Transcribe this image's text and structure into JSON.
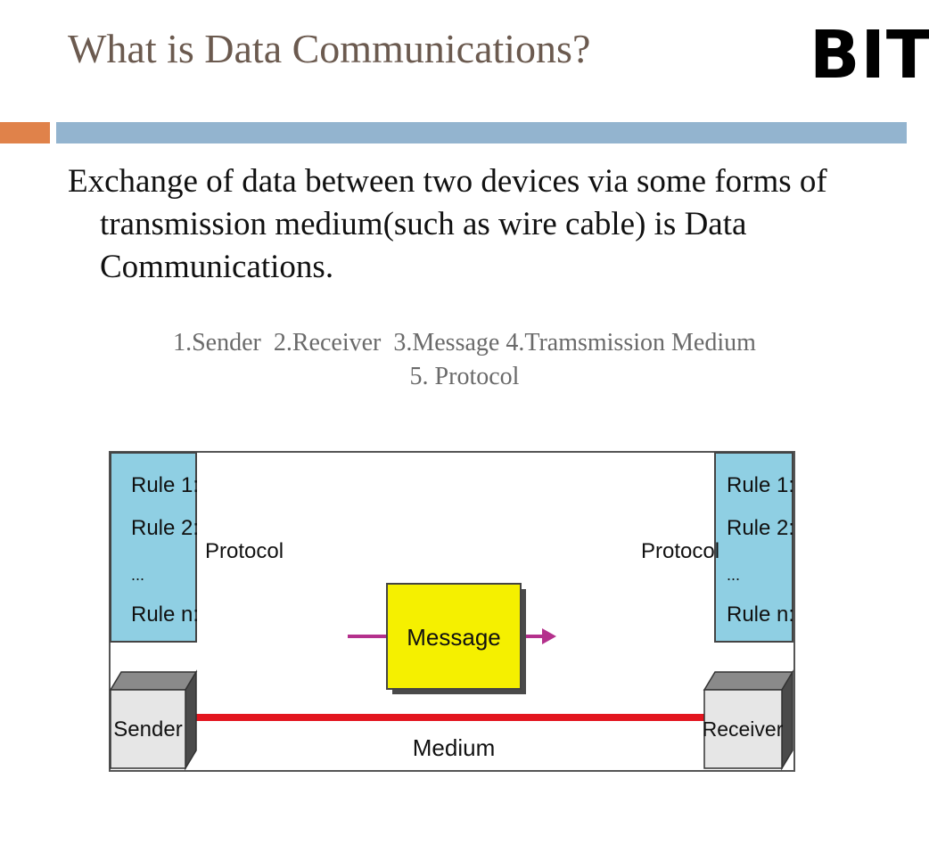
{
  "slide": {
    "title": "What is Data Communications?",
    "logo": "BIT",
    "definition": "Exchange of data between two devices via some forms of transmission medium(such as wire cable) is Data Communications.",
    "components_line1": "1.Sender  2.Receiver  3.Message 4.Tramsmission Medium",
    "components_line2": "5. Protocol",
    "accent_colors": {
      "title": "#6b5a4f",
      "orange_bar": "#e0824a",
      "blue_bar": "#93b4cf"
    }
  },
  "diagram": {
    "left_rules": [
      "Rule 1:",
      "Rule 2:",
      "...",
      "Rule n:"
    ],
    "right_rules": [
      "Rule 1:",
      "Rule 2:",
      "...",
      "Rule n:"
    ],
    "left_protocol_label": "Protocol",
    "right_protocol_label": "Protocol",
    "message_label": "Message",
    "sender_label": "Sender",
    "receiver_label": "Receiver",
    "medium_label": "Medium",
    "colors": {
      "rules_box": "#8fcfe3",
      "message_box": "#f5f000",
      "medium_line": "#e3151f",
      "arrow": "#b4308c",
      "device_front": "#e6e6e6",
      "device_top": "#8a8a8a"
    }
  }
}
